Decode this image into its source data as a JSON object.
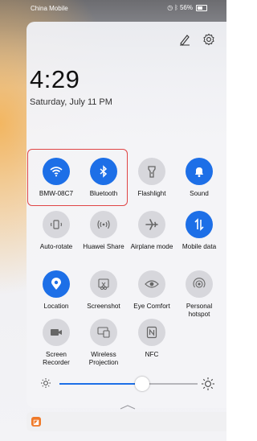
{
  "status_bar": {
    "carrier": "China Mobile",
    "signal": "4G",
    "battery": "56%"
  },
  "clock": {
    "time": "4:29",
    "date": "Saturday, July 11  PM"
  },
  "tiles": [
    {
      "id": "wifi",
      "label": "BMW-08C7",
      "state": "on",
      "icon": "wifi-icon"
    },
    {
      "id": "bluetooth",
      "label": "Bluetooth",
      "state": "on",
      "icon": "bluetooth-icon"
    },
    {
      "id": "flashlight",
      "label": "Flashlight",
      "state": "off",
      "icon": "flashlight-icon"
    },
    {
      "id": "sound",
      "label": "Sound",
      "state": "on",
      "icon": "bell-icon"
    },
    {
      "id": "auto-rotate",
      "label": "Auto-rotate",
      "state": "off",
      "icon": "rotate-icon"
    },
    {
      "id": "huawei-share",
      "label": "Huawei Share",
      "state": "off",
      "icon": "share-wave-icon"
    },
    {
      "id": "airplane",
      "label": "Airplane mode",
      "state": "off",
      "icon": "airplane-icon"
    },
    {
      "id": "mobile-data",
      "label": "Mobile data",
      "state": "on",
      "icon": "data-arrows-icon"
    },
    {
      "id": "location",
      "label": "Location",
      "state": "on",
      "icon": "location-pin-icon"
    },
    {
      "id": "screenshot",
      "label": "Screenshot",
      "state": "off",
      "icon": "scissors-icon"
    },
    {
      "id": "eye-comfort",
      "label": "Eye Comfort",
      "state": "off",
      "icon": "eye-icon"
    },
    {
      "id": "hotspot",
      "label": "Personal hotspot",
      "state": "off",
      "icon": "hotspot-icon"
    },
    {
      "id": "screen-recorder",
      "label": "Screen Recorder",
      "state": "off",
      "icon": "camera-icon"
    },
    {
      "id": "wireless-projection",
      "label": "Wireless Projection",
      "state": "off",
      "icon": "projection-icon"
    },
    {
      "id": "nfc",
      "label": "NFC",
      "state": "off",
      "icon": "nfc-icon"
    }
  ],
  "brightness": {
    "level": 0.6
  },
  "colors": {
    "accent": "#1d6fe7",
    "tile_off": "#d7d7dc",
    "highlight": "#e04545",
    "notification_app": "#ef7a2a"
  },
  "notification": {
    "app_icon": "app-notification-icon"
  }
}
